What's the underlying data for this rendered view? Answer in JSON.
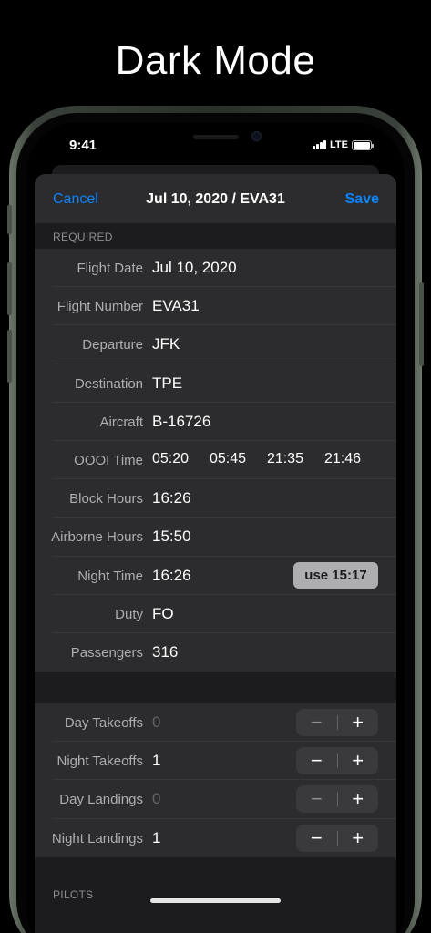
{
  "promo": {
    "title": "Dark Mode"
  },
  "status_bar": {
    "time": "9:41",
    "network": "LTE"
  },
  "nav": {
    "cancel": "Cancel",
    "title": "Jul 10, 2020 / EVA31",
    "save": "Save"
  },
  "required": {
    "header": "REQUIRED",
    "rows": [
      {
        "label": "Flight Date",
        "value": "Jul 10, 2020"
      },
      {
        "label": "Flight Number",
        "value": "EVA31"
      },
      {
        "label": "Departure",
        "value": "JFK"
      },
      {
        "label": "Destination",
        "value": "TPE"
      },
      {
        "label": "Aircraft",
        "value": "B-16726"
      }
    ],
    "oooi": {
      "label": "OOOI Time",
      "out": "05:20",
      "off": "05:45",
      "on": "21:35",
      "in": "21:46"
    },
    "block": {
      "label": "Block Hours",
      "value": "16:26"
    },
    "airborne": {
      "label": "Airborne Hours",
      "value": "15:50"
    },
    "night": {
      "label": "Night Time",
      "value": "16:26",
      "use_button": "use 15:17"
    },
    "duty": {
      "label": "Duty",
      "value": "FO"
    },
    "passengers": {
      "label": "Passengers",
      "value": "316"
    }
  },
  "counters": [
    {
      "label": "Day Takeoffs",
      "value": "0"
    },
    {
      "label": "Night Takeoffs",
      "value": "1"
    },
    {
      "label": "Day Landings",
      "value": "0"
    },
    {
      "label": "Night Landings",
      "value": "1"
    }
  ],
  "stepper": {
    "minus": "−",
    "plus": "+"
  },
  "pilots": {
    "header": "PILOTS"
  }
}
